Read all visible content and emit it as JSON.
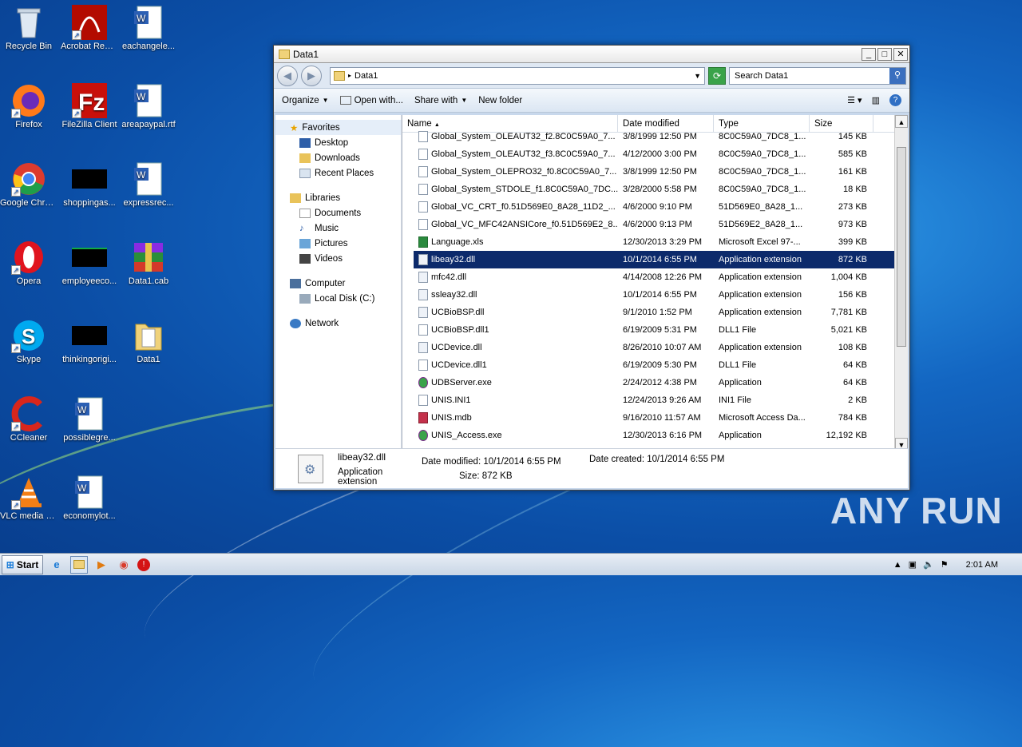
{
  "desktop": {
    "icons": [
      {
        "label": "Recycle Bin",
        "icon": "recycle-bin-icon"
      },
      {
        "label": "Acrobat Reader DC",
        "icon": "acrobat-icon"
      },
      {
        "label": "eachangele...",
        "icon": "word-doc-icon"
      },
      {
        "label": "Firefox",
        "icon": "firefox-icon"
      },
      {
        "label": "FileZilla Client",
        "icon": "filezilla-icon"
      },
      {
        "label": "areapaypal.rtf",
        "icon": "word-doc-icon"
      },
      {
        "label": "Google Chrome",
        "icon": "chrome-icon"
      },
      {
        "label": "shoppingas...",
        "icon": "black-thumbnail-icon"
      },
      {
        "label": "expressrec...",
        "icon": "word-doc-icon"
      },
      {
        "label": "Opera",
        "icon": "opera-icon"
      },
      {
        "label": "employeeco...",
        "icon": "black-thumbnail-icon"
      },
      {
        "label": "Data1.cab",
        "icon": "winrar-icon"
      },
      {
        "label": "Skype",
        "icon": "skype-icon"
      },
      {
        "label": "thinkingorigi...",
        "icon": "black-thumbnail-icon"
      },
      {
        "label": "Data1",
        "icon": "folder-icon"
      },
      {
        "label": "CCleaner",
        "icon": "ccleaner-icon"
      },
      {
        "label": "possiblegre...",
        "icon": "word-doc-icon"
      },
      {
        "label": "VLC media player",
        "icon": "vlc-icon"
      },
      {
        "label": "economylot...",
        "icon": "word-doc-icon"
      }
    ]
  },
  "window": {
    "title": "Data1",
    "address": "Data1",
    "search_placeholder": "Search Data1",
    "toolbar": {
      "organize": "Organize",
      "open_with": "Open with...",
      "share_with": "Share with",
      "new_folder": "New folder"
    },
    "nav": {
      "favorites": "Favorites",
      "desktop": "Desktop",
      "downloads": "Downloads",
      "recent": "Recent Places",
      "libraries": "Libraries",
      "documents": "Documents",
      "music": "Music",
      "pictures": "Pictures",
      "videos": "Videos",
      "computer": "Computer",
      "local_disk": "Local Disk (C:)",
      "network": "Network"
    },
    "columns": {
      "name": "Name",
      "date": "Date modified",
      "type": "Type",
      "size": "Size"
    },
    "files": [
      {
        "name": "Global_System_OLEAUT32_f2.8C0C59A0_7...",
        "date": "3/8/1999 12:50 PM",
        "type": "8C0C59A0_7DC8_1...",
        "size": "145 KB",
        "icon": "file-icon"
      },
      {
        "name": "Global_System_OLEAUT32_f3.8C0C59A0_7...",
        "date": "4/12/2000 3:00 PM",
        "type": "8C0C59A0_7DC8_1...",
        "size": "585 KB",
        "icon": "file-icon"
      },
      {
        "name": "Global_System_OLEPRO32_f0.8C0C59A0_7...",
        "date": "3/8/1999 12:50 PM",
        "type": "8C0C59A0_7DC8_1...",
        "size": "161 KB",
        "icon": "file-icon"
      },
      {
        "name": "Global_System_STDOLE_f1.8C0C59A0_7DC...",
        "date": "3/28/2000 5:58 PM",
        "type": "8C0C59A0_7DC8_1...",
        "size": "18 KB",
        "icon": "file-icon"
      },
      {
        "name": "Global_VC_CRT_f0.51D569E0_8A28_11D2_...",
        "date": "4/6/2000 9:10 PM",
        "type": "51D569E0_8A28_1...",
        "size": "273 KB",
        "icon": "file-icon"
      },
      {
        "name": "Global_VC_MFC42ANSICore_f0.51D569E2_8...",
        "date": "4/6/2000 9:13 PM",
        "type": "51D569E2_8A28_1...",
        "size": "973 KB",
        "icon": "file-icon"
      },
      {
        "name": "Language.xls",
        "date": "12/30/2013 3:29 PM",
        "type": "Microsoft Excel 97-...",
        "size": "399 KB",
        "icon": "excel-icon"
      },
      {
        "name": "libeay32.dll",
        "date": "10/1/2014 6:55 PM",
        "type": "Application extension",
        "size": "872 KB",
        "icon": "dll-icon",
        "selected": true
      },
      {
        "name": "mfc42.dll",
        "date": "4/14/2008 12:26 PM",
        "type": "Application extension",
        "size": "1,004 KB",
        "icon": "dll-icon"
      },
      {
        "name": "ssleay32.dll",
        "date": "10/1/2014 6:55 PM",
        "type": "Application extension",
        "size": "156 KB",
        "icon": "dll-icon"
      },
      {
        "name": "UCBioBSP.dll",
        "date": "9/1/2010 1:52 PM",
        "type": "Application extension",
        "size": "7,781 KB",
        "icon": "dll-icon"
      },
      {
        "name": "UCBioBSP.dll1",
        "date": "6/19/2009 5:31 PM",
        "type": "DLL1 File",
        "size": "5,021 KB",
        "icon": "file-icon"
      },
      {
        "name": "UCDevice.dll",
        "date": "8/26/2010 10:07 AM",
        "type": "Application extension",
        "size": "108 KB",
        "icon": "dll-icon"
      },
      {
        "name": "UCDevice.dll1",
        "date": "6/19/2009 5:30 PM",
        "type": "DLL1 File",
        "size": "64 KB",
        "icon": "file-icon"
      },
      {
        "name": "UDBServer.exe",
        "date": "2/24/2012 4:38 PM",
        "type": "Application",
        "size": "64 KB",
        "icon": "exe-icon"
      },
      {
        "name": "UNIS.INI1",
        "date": "12/24/2013 9:26 AM",
        "type": "INI1 File",
        "size": "2 KB",
        "icon": "file-icon"
      },
      {
        "name": "UNIS.mdb",
        "date": "9/16/2010 11:57 AM",
        "type": "Microsoft Access Da...",
        "size": "784 KB",
        "icon": "access-icon"
      },
      {
        "name": "UNIS_Access.exe",
        "date": "12/30/2013 6:16 PM",
        "type": "Application",
        "size": "12,192 KB",
        "icon": "exe-icon"
      }
    ],
    "details": {
      "name": "libeay32.dll",
      "type": "Application extension",
      "modified_label": "Date modified:",
      "modified": "10/1/2014 6:55 PM",
      "created_label": "Date created:",
      "created": "10/1/2014 6:55 PM",
      "size_label": "Size:",
      "size": "872 KB"
    }
  },
  "taskbar": {
    "start": "Start",
    "clock": "2:01 AM"
  },
  "watermark": "ANY RUN"
}
